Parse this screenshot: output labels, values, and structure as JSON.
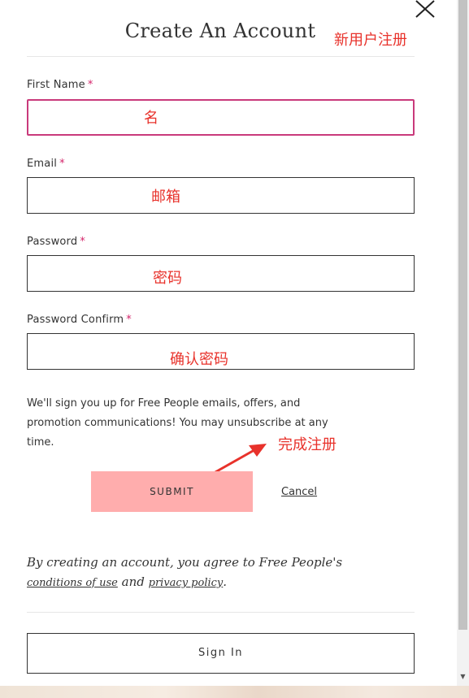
{
  "modal": {
    "title": "Create An Account",
    "close_icon": "close-icon"
  },
  "annotations": {
    "title_note": "新用户注册",
    "first_name_note": "名",
    "email_note": "邮箱",
    "password_note": "密码",
    "password_confirm_note": "确认密码",
    "submit_note": "完成注册",
    "arrow_color": "#e8322b"
  },
  "form": {
    "required_mark": "*",
    "fields": [
      {
        "label": "First Name",
        "value": "",
        "focused": true
      },
      {
        "label": "Email",
        "value": ""
      },
      {
        "label": "Password",
        "value": ""
      },
      {
        "label": "Password Confirm",
        "value": ""
      }
    ],
    "notice": "We'll sign you up for Free People emails, offers, and promotion communications! You may unsubscribe at any time.",
    "submit_label": "SUBMIT",
    "cancel_label": "Cancel",
    "agree_prefix": "By creating an account, you agree to Free People's",
    "terms_link": "conditions of use",
    "agree_and": "and",
    "privacy_link": "privacy policy",
    "agree_period": "."
  },
  "footer": {
    "signin_label": "Sign In"
  },
  "colors": {
    "submit_bg": "#ffadad",
    "focus_border": "#c93a7b",
    "required": "#d4246a",
    "annotation": "#e8322b"
  }
}
